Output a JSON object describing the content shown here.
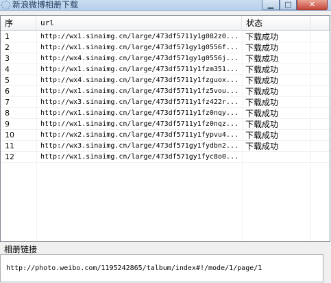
{
  "window": {
    "title": "新浪微博相册下载",
    "minimize_glyph": "▁",
    "maximize_glyph": "□",
    "close_glyph": "✕"
  },
  "list": {
    "columns": {
      "seq": "序",
      "url": "url",
      "status": "状态",
      "extra": ""
    },
    "rows": [
      {
        "seq": "1",
        "url": "http://wx1.sinaimg.cn/large/473df5711y1g082z0...",
        "status": "下载成功"
      },
      {
        "seq": "2",
        "url": "http://wx1.sinaimg.cn/large/473df571gy1g0556f...",
        "status": "下载成功"
      },
      {
        "seq": "3",
        "url": "http://wx4.sinaimg.cn/large/473df571gy1g0556j...",
        "status": "下载成功"
      },
      {
        "seq": "4",
        "url": "http://wx1.sinaimg.cn/large/473df5711y1fzm351...",
        "status": "下载成功"
      },
      {
        "seq": "5",
        "url": "http://wx4.sinaimg.cn/large/473df5711y1fzguox...",
        "status": "下载成功"
      },
      {
        "seq": "6",
        "url": "http://wx1.sinaimg.cn/large/473df5711y1fz5vou...",
        "status": "下载成功"
      },
      {
        "seq": "7",
        "url": "http://wx3.sinaimg.cn/large/473df5711y1fz422r...",
        "status": "下载成功"
      },
      {
        "seq": "8",
        "url": "http://wx1.sinaimg.cn/large/473df5711y1fz0nqy...",
        "status": "下载成功"
      },
      {
        "seq": "9",
        "url": "http://wx1.sinaimg.cn/large/473df5711y1fz0nqz...",
        "status": "下载成功"
      },
      {
        "seq": "10",
        "url": "http://wx2.sinaimg.cn/large/473df5711y1fypvu4...",
        "status": "下载成功"
      },
      {
        "seq": "11",
        "url": "http://wx3.sinaimg.cn/large/473df571gy1fydbn2...",
        "status": "下载成功"
      },
      {
        "seq": "12",
        "url": "http://wx1.sinaimg.cn/large/473df571gy1fyc8o0...",
        "status": ""
      }
    ]
  },
  "album": {
    "label": "相册链接",
    "value": "http://photo.weibo.com/1195242865/talbum/index#!/mode/1/page/1"
  }
}
